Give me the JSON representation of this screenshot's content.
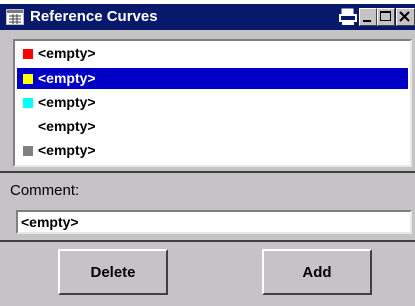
{
  "window": {
    "title": "Reference Curves"
  },
  "list": {
    "items": [
      {
        "label": "<empty>",
        "color": "#ff0000",
        "selected": false
      },
      {
        "label": "<empty>",
        "color": "#ffff00",
        "selected": true
      },
      {
        "label": "<empty>",
        "color": "#00ffff",
        "selected": false
      },
      {
        "label": "<empty>",
        "color": "#ffffff",
        "selected": false
      },
      {
        "label": "<empty>",
        "color": "#808080",
        "selected": false
      }
    ]
  },
  "comment": {
    "label": "Comment:",
    "value": "<empty>"
  },
  "buttons": {
    "delete_label": "Delete",
    "add_label": "Add"
  },
  "colors": {
    "titlebar": "#08186b",
    "selection": "#0000c6",
    "dialog_bg": "#c6c3c6"
  }
}
